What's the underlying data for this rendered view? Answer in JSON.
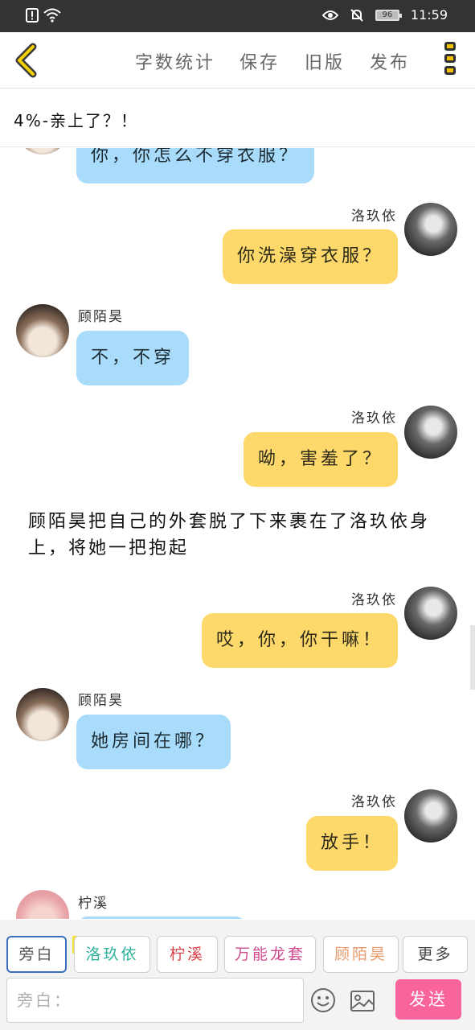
{
  "status_bar": {
    "battery": "96",
    "time": "11:59"
  },
  "toolbar": {
    "word_count": "字数统计",
    "save": "保存",
    "old_version": "旧版",
    "publish": "发布"
  },
  "chapter": {
    "title": "4%-亲上了？！"
  },
  "messages": [
    {
      "side": "left",
      "speaker": "",
      "text": "你，你怎么不穿衣服？",
      "color": "#a8dcfa"
    },
    {
      "side": "right",
      "speaker": "洛玖依",
      "text": "你洗澡穿衣服？",
      "color": "#fcd96a"
    },
    {
      "side": "left",
      "speaker": "顾陌昊",
      "text": "不，不穿",
      "color": "#a8dcfa"
    },
    {
      "side": "right",
      "speaker": "洛玖依",
      "text": "呦，害羞了？",
      "color": "#fcd96a"
    },
    {
      "side": "right",
      "speaker": "洛玖依",
      "text": "哎，你，你干嘛！",
      "color": "#fcd96a"
    },
    {
      "side": "left",
      "speaker": "顾陌昊",
      "text": "她房间在哪？",
      "color": "#a8dcfa"
    },
    {
      "side": "right",
      "speaker": "洛玖依",
      "text": "放手！",
      "color": "#fcd96a"
    },
    {
      "side": "left",
      "speaker": "柠溪",
      "text": "",
      "color": "#a8dcfa"
    }
  ],
  "narration": "顾陌昊把自己的外套脱了下来裹在了洛玖依身上，将她一把抱起",
  "roles": [
    {
      "label": "旁白",
      "color": "#555555"
    },
    {
      "label": "洛玖依",
      "color": "#2fb39a"
    },
    {
      "label": "柠溪",
      "color": "#d8424a"
    },
    {
      "label": "万能龙套",
      "color": "#d04a8f"
    },
    {
      "label": "顾陌昊",
      "color": "#e89a6a"
    },
    {
      "label": "更多",
      "color": "#444444"
    }
  ],
  "main_tag": "主",
  "input": {
    "placeholder": "旁白："
  },
  "send_label": "发送"
}
